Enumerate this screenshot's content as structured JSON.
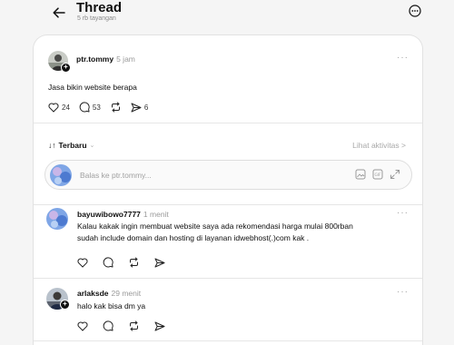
{
  "header": {
    "title": "Thread",
    "subtitle": "5 rb tayangan"
  },
  "post": {
    "username": "ptr.tommy",
    "time": "5 jam",
    "text": "Jasa bikin website berapa",
    "likes": "24",
    "comments": "53",
    "shares": "6"
  },
  "sort": {
    "label": "Terbaru",
    "activity_label": "Lihat aktivitas",
    "activity_arrow": ">"
  },
  "reply": {
    "placeholder": "Balas ke ptr.tommy..."
  },
  "replies": [
    {
      "username": "bayuwibowo7777",
      "time": "1 menit",
      "line1": "Kalau kakak ingin membuat website saya ada rekomendasi harga mulai 800rban",
      "line2": "sudah include domain dan hosting di layanan idwebhost(.)com kak ."
    },
    {
      "username": "arlaksde",
      "time": "29 menit",
      "line1": "halo kak bisa dm ya"
    }
  ],
  "colors": {
    "background": "#f5f5f5",
    "card": "#ffffff",
    "text": "#101010",
    "muted": "#9a9a9a"
  }
}
